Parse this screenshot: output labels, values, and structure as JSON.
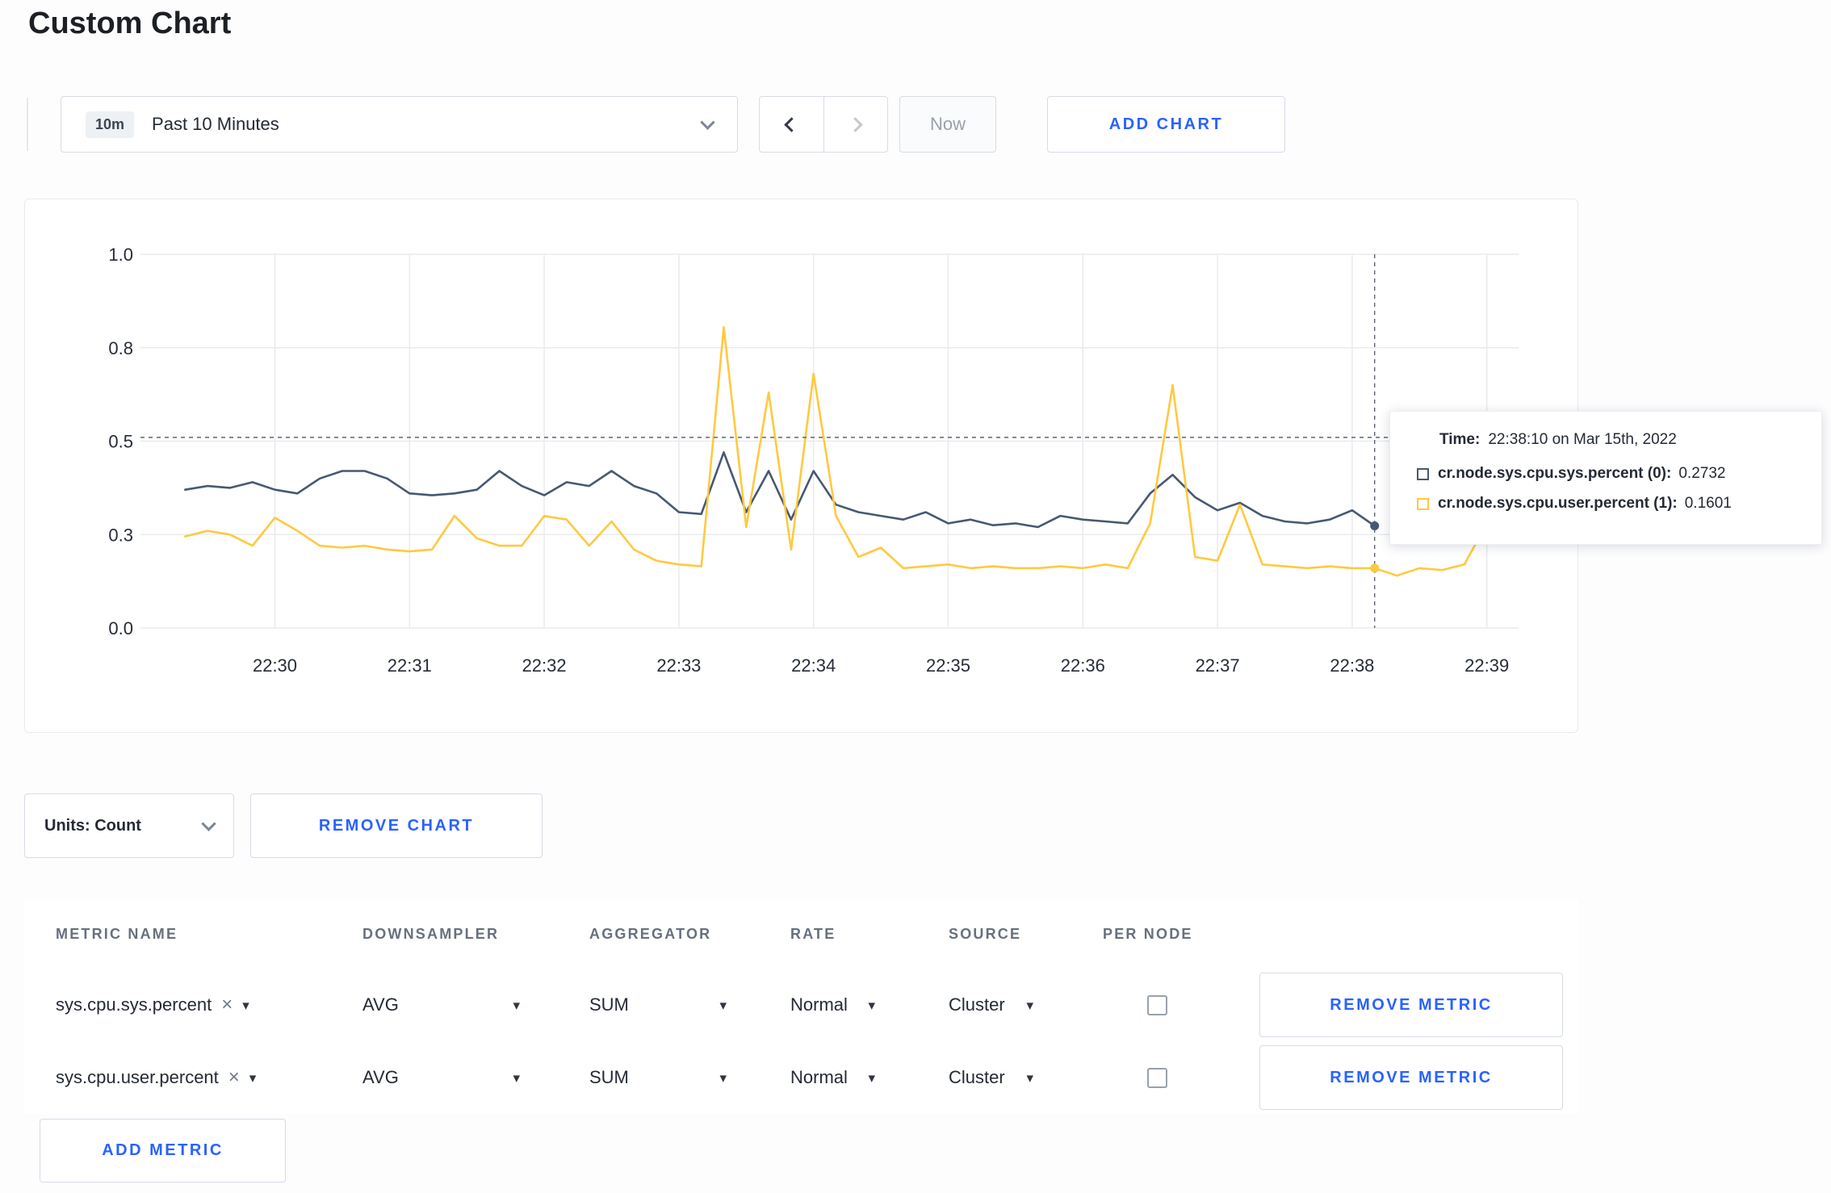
{
  "colors": {
    "accent_blue": "#2962ff",
    "series_sys": "#475872",
    "series_user": "#ffc940",
    "grid": "#e9ebef",
    "crosshair": "#5b6573"
  },
  "header": {
    "title": "Custom Chart"
  },
  "toolbar": {
    "time_range": {
      "badge": "10m",
      "label": "Past 10 Minutes"
    },
    "now_label": "Now",
    "add_chart_label": "ADD CHART"
  },
  "chart_data": {
    "type": "line",
    "title": "",
    "ylim": [
      0,
      1
    ],
    "y_ticks": [
      {
        "value": 1.0,
        "label": "1.0"
      },
      {
        "value": 0.75,
        "label": "0.8"
      },
      {
        "value": 0.5,
        "label": "0.5"
      },
      {
        "value": 0.25,
        "label": "0.3"
      },
      {
        "value": 0.0,
        "label": "0.0"
      }
    ],
    "x_ticks": [
      "22:30",
      "22:31",
      "22:32",
      "22:33",
      "22:34",
      "22:35",
      "22:36",
      "22:37",
      "22:38",
      "22:39"
    ],
    "x_start_offset_min": -0.6667,
    "x_interval_sec": 10,
    "grid": true,
    "series": [
      {
        "name": "cr.node.sys.cpu.sys.percent",
        "color": "#475872",
        "values": [
          0.37,
          0.38,
          0.375,
          0.39,
          0.37,
          0.36,
          0.4,
          0.42,
          0.42,
          0.4,
          0.36,
          0.355,
          0.36,
          0.37,
          0.42,
          0.38,
          0.355,
          0.39,
          0.38,
          0.42,
          0.38,
          0.36,
          0.31,
          0.305,
          0.47,
          0.31,
          0.42,
          0.29,
          0.42,
          0.33,
          0.31,
          0.3,
          0.29,
          0.31,
          0.28,
          0.29,
          0.275,
          0.28,
          0.27,
          0.3,
          0.29,
          0.285,
          0.28,
          0.36,
          0.41,
          0.35,
          0.315,
          0.335,
          0.3,
          0.285,
          0.28,
          0.29,
          0.315,
          0.2732
        ]
      },
      {
        "name": "cr.node.sys.cpu.user.percent",
        "color": "#ffc940",
        "values": [
          0.245,
          0.26,
          0.25,
          0.22,
          0.295,
          0.26,
          0.22,
          0.215,
          0.22,
          0.21,
          0.205,
          0.21,
          0.3,
          0.24,
          0.22,
          0.22,
          0.3,
          0.29,
          0.22,
          0.285,
          0.21,
          0.18,
          0.17,
          0.165,
          0.805,
          0.27,
          0.63,
          0.21,
          0.68,
          0.3,
          0.19,
          0.215,
          0.16,
          0.165,
          0.17,
          0.16,
          0.165,
          0.16,
          0.16,
          0.165,
          0.16,
          0.17,
          0.16,
          0.28,
          0.65,
          0.19,
          0.18,
          0.33,
          0.17,
          0.165,
          0.16,
          0.165,
          0.16,
          0.1601,
          0.14,
          0.16,
          0.155,
          0.17,
          0.28,
          0.235
        ]
      }
    ],
    "crosshair": {
      "time_offset_min": 8.1667,
      "hline_value": 0.51
    },
    "tooltip": {
      "time_label": "Time:",
      "time_value": "22:38:10 on Mar 15th, 2022",
      "entries": [
        {
          "label": "cr.node.sys.cpu.sys.percent (0):",
          "value": "0.2732",
          "color": "#475872"
        },
        {
          "label": "cr.node.sys.cpu.user.percent (1):",
          "value": "0.1601",
          "color": "#ffc940"
        }
      ]
    }
  },
  "units": {
    "label": "Units: Count"
  },
  "chart_actions": {
    "remove_chart_label": "REMOVE CHART"
  },
  "table": {
    "columns": [
      "METRIC NAME",
      "DOWNSAMPLER",
      "AGGREGATOR",
      "RATE",
      "SOURCE",
      "PER NODE"
    ],
    "rows": [
      {
        "metric_name": "sys.cpu.sys.percent",
        "clear": "×",
        "downsampler": "AVG",
        "aggregator": "SUM",
        "rate": "Normal",
        "source": "Cluster",
        "per_node_checked": false,
        "remove_label": "REMOVE METRIC"
      },
      {
        "metric_name": "sys.cpu.user.percent",
        "clear": "×",
        "downsampler": "AVG",
        "aggregator": "SUM",
        "rate": "Normal",
        "source": "Cluster",
        "per_node_checked": false,
        "remove_label": "REMOVE METRIC"
      }
    ],
    "add_metric_label": "ADD METRIC"
  },
  "icons": {
    "caret_down": "▾"
  }
}
